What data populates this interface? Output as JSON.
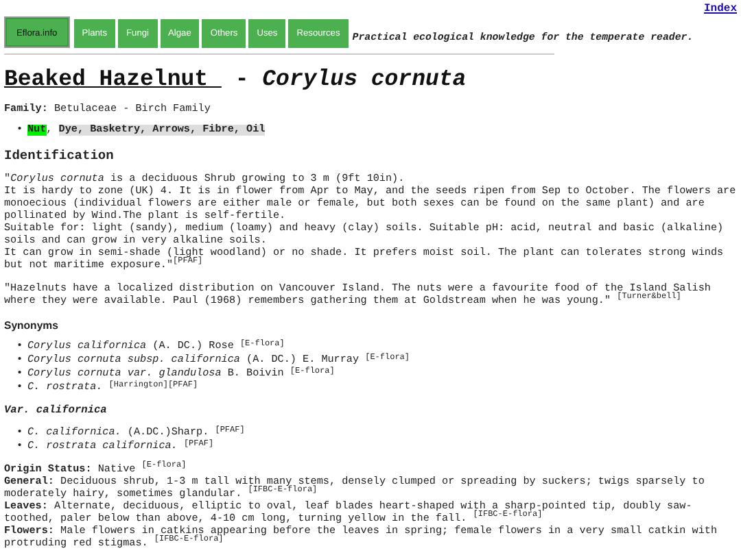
{
  "index_link": "Index",
  "nav": {
    "tabs": [
      {
        "label": "Eflora.info",
        "selected": true
      },
      {
        "label": "Plants",
        "selected": false
      },
      {
        "label": "Fungi",
        "selected": false
      },
      {
        "label": "Algae",
        "selected": false
      },
      {
        "label": "Others",
        "selected": false
      },
      {
        "label": "Uses",
        "selected": false
      },
      {
        "label": "Resources",
        "selected": false
      }
    ],
    "tagline": "Practical ecological knowledge for the temperate reader."
  },
  "title": {
    "common_name": "Beaked Hazelnut ",
    "separator": "-",
    "scientific_name": "Corylus cornuta"
  },
  "family": {
    "label": "Family:",
    "value": "Betulaceae - Birch Family"
  },
  "list_marker": "•",
  "uses": [
    {
      "text": "Nut",
      "kind": "primary"
    },
    {
      "text": ",",
      "kind": "plain"
    },
    {
      "text": "Dye, Basketry, Arrows, Fibre, Oil",
      "kind": "secondary"
    }
  ],
  "identification": {
    "heading": "Identification",
    "paragraphs": [
      "\"*Corylus cornuta* is a deciduous Shrub growing to 3 m (9ft 10in).\nIt is hardy to zone (UK) 4. It is in flower from Apr to May, and the seeds ripen from Sep to October. The flowers are monoecious (individual flowers are either male or female, but both sexes can be found on the same plant) and are pollinated by Wind.The plant is self-fertile.\nSuitable for: light (sandy), medium (loamy) and heavy (clay) soils. Suitable pH: acid, neutral and basic (alkaline) soils and can grow in very alkaline soils.\nIt can grow in semi-shade (light woodland) or no shade. It prefers moist soil. The plant can tolerates strong winds but not maritime exposure.\"$^{[PFAF]}$",
      "\"Hazelnuts have a localized distribution on Vancouver Island. The nuts were a favourite food of the Island Salish where they were available. Paul (1968) remembers gathering them at Goldstream when he was young.\" $^{[Turner&bell]}$"
    ]
  },
  "synonyms": {
    "heading": "Synonyms",
    "items": [
      "*Corylus californica* (A. DC.) Rose $^{[E-flora]}$",
      "*Corylus cornuta subsp. californica* (A. DC.) E. Murray $^{[E-flora]}$",
      "*Corylus cornuta var. glandulosa* B. Boivin $^{[E-flora]}$",
      "*C. rostrata.* $^{[Harrington][PFAF]}$"
    ]
  },
  "variety": {
    "heading": "Var. californica",
    "items": [
      "*C. californica.* (A.DC.)Sharp. $^{[PFAF]}$",
      "*C. rostrata californica.* $^{[PFAF]}$"
    ]
  },
  "details": [
    {
      "label": "Origin Status:",
      "text": "Native $^{[E-flora]}$"
    },
    {
      "label": "General:",
      "text": "Deciduous shrub, 1-3 m tall with many stems, densely clumped or spreading by suckers; twigs sparsely to moderately hairy, sometimes glandular. $^{[IFBC-E-flora]}$"
    },
    {
      "label": "Leaves:",
      "text": "Alternate, deciduous, elliptic to oval, leaf blades heart-shaped with a sharp-pointed tip, doubly saw-toothed, paler below than above, 4-10 cm long, turning yellow in the fall. $^{[IFBC-E-flora]}$"
    },
    {
      "label": "Flowers:",
      "text": "Male flowers in catkins appearing before the leaves in spring; female flowers in a very small catkin with protruding red stigmas. $^{[IFBC-E-flora]}$"
    }
  ]
}
